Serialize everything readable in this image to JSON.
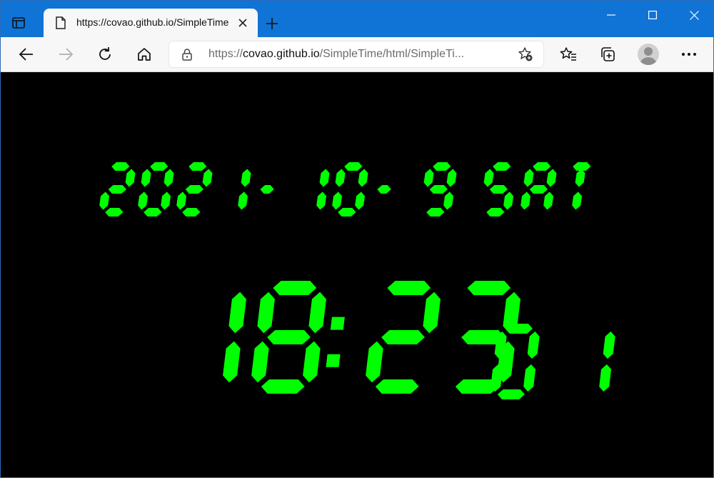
{
  "browser": {
    "tab": {
      "title": "https://covao.github.io/SimpleTime"
    },
    "address": {
      "prefix": "https://",
      "host": "covao.github.io",
      "path": "/SimpleTime/html/SimpleTi..."
    }
  },
  "icons": {
    "tab_actions": "tab-actions-icon",
    "favicon": "page-icon",
    "close": "close-icon",
    "new_tab": "plus-icon",
    "back": "back-arrow-icon",
    "forward": "forward-arrow-icon",
    "refresh": "refresh-icon",
    "home": "home-icon",
    "lock": "lock-icon",
    "add_favorite": "star-add-icon",
    "favorites": "favorites-icon",
    "collections": "collections-icon",
    "profile": "avatar",
    "more": "more-icon"
  },
  "clock": {
    "year": "2021",
    "month": "10",
    "day": "9",
    "weekday": "SAT",
    "hours": "18",
    "minutes": "23",
    "seconds": "01"
  },
  "colors": {
    "segment": "#00ff00",
    "background": "#000000",
    "titlebar": "#0f74d6"
  }
}
